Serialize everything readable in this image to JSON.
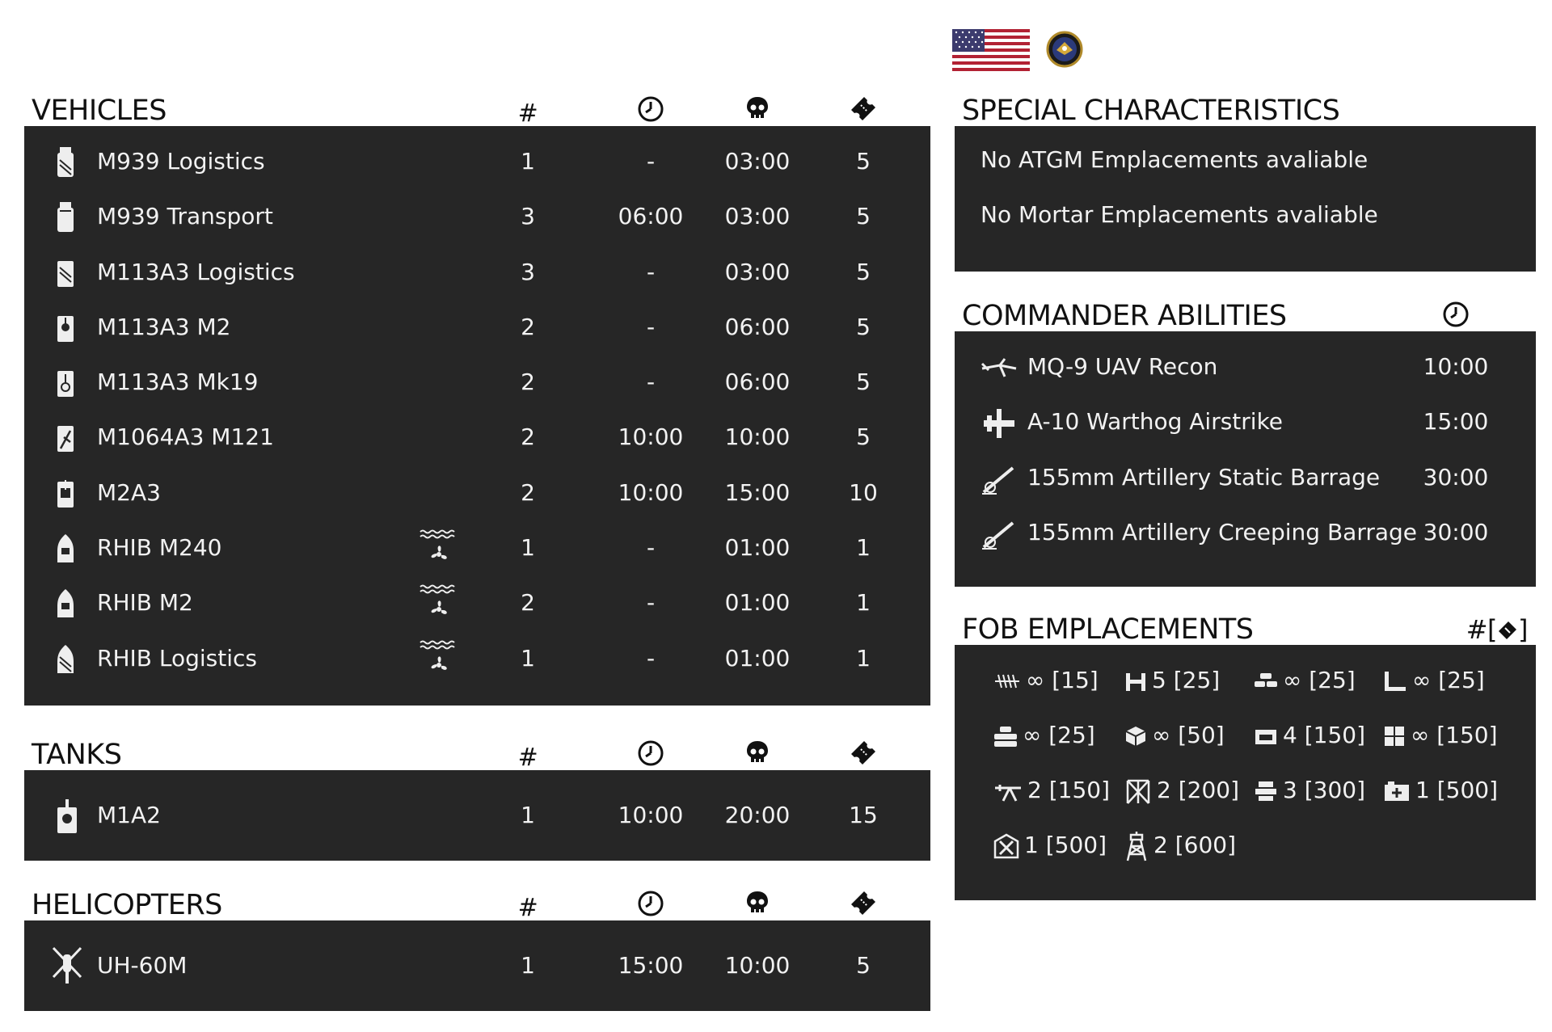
{
  "headers": {
    "vehicles": "VEHICLES",
    "tanks": "TANKS",
    "helicopters": "HELICOPTERS",
    "special": "SPECIAL CHARACTERISTICS",
    "commander": "COMMANDER ABILITIES",
    "fob": "FOB EMPLACEMENTS",
    "count_symbol": "#",
    "fob_count_symbol": "#[",
    "fob_count_close": "]"
  },
  "vehicles": [
    {
      "icon": "logistics-truck-icon",
      "name": "M939 Logistics",
      "count": "1",
      "delay": "-",
      "respawn": "03:00",
      "tickets": "5",
      "amphibious": false
    },
    {
      "icon": "transport-truck-icon",
      "name": "M939 Transport",
      "count": "3",
      "delay": "06:00",
      "respawn": "03:00",
      "tickets": "5",
      "amphibious": false
    },
    {
      "icon": "apc-logistics-icon",
      "name": "M113A3 Logistics",
      "count": "3",
      "delay": "-",
      "respawn": "03:00",
      "tickets": "5",
      "amphibious": false
    },
    {
      "icon": "apc-m2-icon",
      "name": "M113A3 M2",
      "count": "2",
      "delay": "-",
      "respawn": "06:00",
      "tickets": "5",
      "amphibious": false
    },
    {
      "icon": "apc-mk19-icon",
      "name": "M113A3 Mk19",
      "count": "2",
      "delay": "-",
      "respawn": "06:00",
      "tickets": "5",
      "amphibious": false
    },
    {
      "icon": "mortar-carrier-icon",
      "name": "M1064A3 M121",
      "count": "2",
      "delay": "10:00",
      "respawn": "10:00",
      "tickets": "5",
      "amphibious": false
    },
    {
      "icon": "ifv-icon",
      "name": "M2A3",
      "count": "2",
      "delay": "10:00",
      "respawn": "15:00",
      "tickets": "10",
      "amphibious": false
    },
    {
      "icon": "boat-icon",
      "name": "RHIB M240",
      "count": "1",
      "delay": "-",
      "respawn": "01:00",
      "tickets": "1",
      "amphibious": true
    },
    {
      "icon": "boat-icon",
      "name": "RHIB M2",
      "count": "2",
      "delay": "-",
      "respawn": "01:00",
      "tickets": "1",
      "amphibious": true
    },
    {
      "icon": "boat-logistics-icon",
      "name": "RHIB Logistics",
      "count": "1",
      "delay": "-",
      "respawn": "01:00",
      "tickets": "1",
      "amphibious": true
    }
  ],
  "tanks": [
    {
      "icon": "tank-icon",
      "name": "M1A2",
      "count": "1",
      "delay": "10:00",
      "respawn": "20:00",
      "tickets": "15"
    }
  ],
  "helicopters": [
    {
      "icon": "helicopter-icon",
      "name": "UH-60M",
      "count": "1",
      "delay": "15:00",
      "respawn": "10:00",
      "tickets": "5"
    }
  ],
  "special": [
    "No ATGM Emplacements avaliable",
    "No Mortar Emplacements avaliable"
  ],
  "abilities": [
    {
      "icon": "uav-icon",
      "name": "MQ-9 UAV Recon",
      "time": "10:00"
    },
    {
      "icon": "airstrike-icon",
      "name": "A-10 Warthog Airstrike",
      "time": "15:00"
    },
    {
      "icon": "artillery-icon",
      "name": "155mm Artillery Static Barrage",
      "time": "30:00"
    },
    {
      "icon": "artillery-icon",
      "name": "155mm Artillery Creeping Barrage",
      "time": "30:00"
    }
  ],
  "fob": [
    {
      "icon": "razorwire-icon",
      "text": "∞ [15]"
    },
    {
      "icon": "hesco-gate-icon",
      "text": "5 [25]"
    },
    {
      "icon": "sandbag-icon",
      "text": "∞ [25]"
    },
    {
      "icon": "wall-corner-icon",
      "text": "∞ [25]"
    },
    {
      "icon": "sandbag-wall-icon",
      "text": "∞ [25]"
    },
    {
      "icon": "crate-icon",
      "text": "∞ [50]"
    },
    {
      "icon": "bunker-icon",
      "text": "4 [150]"
    },
    {
      "icon": "hesco-block-icon",
      "text": "∞ [150]"
    },
    {
      "icon": "hmg-emplacement-icon",
      "text": "2 [150]"
    },
    {
      "icon": "tower-icon",
      "text": "2 [200]"
    },
    {
      "icon": "ammo-crate-icon",
      "text": "3 [300]"
    },
    {
      "icon": "medical-bunker-icon",
      "text": "1 [500]"
    },
    {
      "icon": "repair-station-icon",
      "text": "1 [500]"
    },
    {
      "icon": "radio-tower-icon",
      "text": "2 [600]"
    }
  ],
  "colors": {
    "panel": "#262626",
    "text_light": "#f2f2f2",
    "flag_red": "#b22234",
    "flag_blue": "#3c3b6e"
  }
}
